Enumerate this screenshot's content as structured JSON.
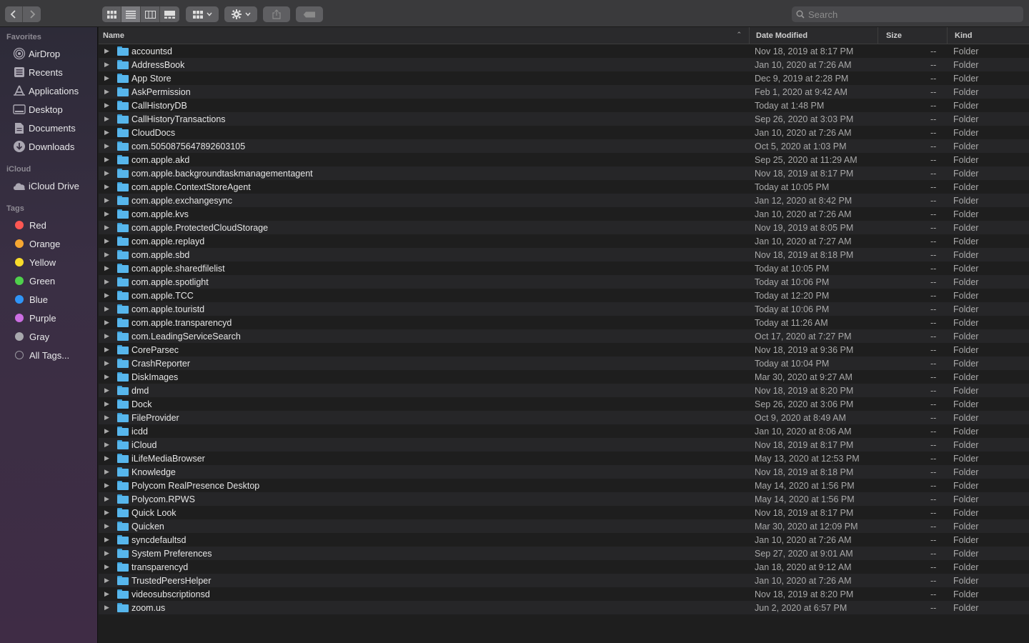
{
  "toolbar": {
    "back_icon": "chevron-left-icon",
    "forward_icon": "chevron-right-icon",
    "view_icons": [
      "icon-view-icon",
      "list-view-icon",
      "column-view-icon",
      "gallery-view-icon"
    ],
    "search_placeholder": "Search"
  },
  "sidebar": {
    "favorites_title": "Favorites",
    "favorites": [
      {
        "label": "AirDrop",
        "icon": "airdrop-icon"
      },
      {
        "label": "Recents",
        "icon": "recents-icon"
      },
      {
        "label": "Applications",
        "icon": "applications-icon"
      },
      {
        "label": "Desktop",
        "icon": "desktop-icon"
      },
      {
        "label": "Documents",
        "icon": "documents-icon"
      },
      {
        "label": "Downloads",
        "icon": "downloads-icon"
      }
    ],
    "icloud_title": "iCloud",
    "icloud": [
      {
        "label": "iCloud Drive",
        "icon": "icloud-icon"
      }
    ],
    "tags_title": "Tags",
    "tags": [
      {
        "label": "Red",
        "color": "#fd5753"
      },
      {
        "label": "Orange",
        "color": "#f6a732"
      },
      {
        "label": "Yellow",
        "color": "#f9dc2b"
      },
      {
        "label": "Green",
        "color": "#4fd04c"
      },
      {
        "label": "Blue",
        "color": "#2f95f7"
      },
      {
        "label": "Purple",
        "color": "#cc6ee2"
      },
      {
        "label": "Gray",
        "color": "#a8a8ad"
      },
      {
        "label": "All Tags...",
        "color": ""
      }
    ]
  },
  "columns": {
    "name": "Name",
    "date": "Date Modified",
    "size": "Size",
    "kind": "Kind"
  },
  "files": [
    {
      "name": "accountsd",
      "date": "Nov 18, 2019 at 8:17 PM",
      "size": "--",
      "kind": "Folder"
    },
    {
      "name": "AddressBook",
      "date": "Jan 10, 2020 at 7:26 AM",
      "size": "--",
      "kind": "Folder"
    },
    {
      "name": "App Store",
      "date": "Dec 9, 2019 at 2:28 PM",
      "size": "--",
      "kind": "Folder"
    },
    {
      "name": "AskPermission",
      "date": "Feb 1, 2020 at 9:42 AM",
      "size": "--",
      "kind": "Folder"
    },
    {
      "name": "CallHistoryDB",
      "date": "Today at 1:48 PM",
      "size": "--",
      "kind": "Folder"
    },
    {
      "name": "CallHistoryTransactions",
      "date": "Sep 26, 2020 at 3:03 PM",
      "size": "--",
      "kind": "Folder"
    },
    {
      "name": "CloudDocs",
      "date": "Jan 10, 2020 at 7:26 AM",
      "size": "--",
      "kind": "Folder"
    },
    {
      "name": "com.5050875647892603105",
      "date": "Oct 5, 2020 at 1:03 PM",
      "size": "--",
      "kind": "Folder"
    },
    {
      "name": "com.apple.akd",
      "date": "Sep 25, 2020 at 11:29 AM",
      "size": "--",
      "kind": "Folder"
    },
    {
      "name": "com.apple.backgroundtaskmanagementagent",
      "date": "Nov 18, 2019 at 8:17 PM",
      "size": "--",
      "kind": "Folder"
    },
    {
      "name": "com.apple.ContextStoreAgent",
      "date": "Today at 10:05 PM",
      "size": "--",
      "kind": "Folder"
    },
    {
      "name": "com.apple.exchangesync",
      "date": "Jan 12, 2020 at 8:42 PM",
      "size": "--",
      "kind": "Folder"
    },
    {
      "name": "com.apple.kvs",
      "date": "Jan 10, 2020 at 7:26 AM",
      "size": "--",
      "kind": "Folder"
    },
    {
      "name": "com.apple.ProtectedCloudStorage",
      "date": "Nov 19, 2019 at 8:05 PM",
      "size": "--",
      "kind": "Folder"
    },
    {
      "name": "com.apple.replayd",
      "date": "Jan 10, 2020 at 7:27 AM",
      "size": "--",
      "kind": "Folder"
    },
    {
      "name": "com.apple.sbd",
      "date": "Nov 18, 2019 at 8:18 PM",
      "size": "--",
      "kind": "Folder"
    },
    {
      "name": "com.apple.sharedfilelist",
      "date": "Today at 10:05 PM",
      "size": "--",
      "kind": "Folder"
    },
    {
      "name": "com.apple.spotlight",
      "date": "Today at 10:06 PM",
      "size": "--",
      "kind": "Folder"
    },
    {
      "name": "com.apple.TCC",
      "date": "Today at 12:20 PM",
      "size": "--",
      "kind": "Folder"
    },
    {
      "name": "com.apple.touristd",
      "date": "Today at 10:06 PM",
      "size": "--",
      "kind": "Folder"
    },
    {
      "name": "com.apple.transparencyd",
      "date": "Today at 11:26 AM",
      "size": "--",
      "kind": "Folder"
    },
    {
      "name": "com.LeadingServiceSearch",
      "date": "Oct 17, 2020 at 7:27 PM",
      "size": "--",
      "kind": "Folder"
    },
    {
      "name": "CoreParsec",
      "date": "Nov 18, 2019 at 9:36 PM",
      "size": "--",
      "kind": "Folder"
    },
    {
      "name": "CrashReporter",
      "date": "Today at 10:04 PM",
      "size": "--",
      "kind": "Folder"
    },
    {
      "name": "DiskImages",
      "date": "Mar 30, 2020 at 9:27 AM",
      "size": "--",
      "kind": "Folder"
    },
    {
      "name": "dmd",
      "date": "Nov 18, 2019 at 8:20 PM",
      "size": "--",
      "kind": "Folder"
    },
    {
      "name": "Dock",
      "date": "Sep 26, 2020 at 3:06 PM",
      "size": "--",
      "kind": "Folder"
    },
    {
      "name": "FileProvider",
      "date": "Oct 9, 2020 at 8:49 AM",
      "size": "--",
      "kind": "Folder"
    },
    {
      "name": "icdd",
      "date": "Jan 10, 2020 at 8:06 AM",
      "size": "--",
      "kind": "Folder"
    },
    {
      "name": "iCloud",
      "date": "Nov 18, 2019 at 8:17 PM",
      "size": "--",
      "kind": "Folder"
    },
    {
      "name": "iLifeMediaBrowser",
      "date": "May 13, 2020 at 12:53 PM",
      "size": "--",
      "kind": "Folder"
    },
    {
      "name": "Knowledge",
      "date": "Nov 18, 2019 at 8:18 PM",
      "size": "--",
      "kind": "Folder"
    },
    {
      "name": "Polycom RealPresence Desktop",
      "date": "May 14, 2020 at 1:56 PM",
      "size": "--",
      "kind": "Folder"
    },
    {
      "name": "Polycom.RPWS",
      "date": "May 14, 2020 at 1:56 PM",
      "size": "--",
      "kind": "Folder"
    },
    {
      "name": "Quick Look",
      "date": "Nov 18, 2019 at 8:17 PM",
      "size": "--",
      "kind": "Folder"
    },
    {
      "name": "Quicken",
      "date": "Mar 30, 2020 at 12:09 PM",
      "size": "--",
      "kind": "Folder"
    },
    {
      "name": "syncdefaultsd",
      "date": "Jan 10, 2020 at 7:26 AM",
      "size": "--",
      "kind": "Folder"
    },
    {
      "name": "System Preferences",
      "date": "Sep 27, 2020 at 9:01 AM",
      "size": "--",
      "kind": "Folder"
    },
    {
      "name": "transparencyd",
      "date": "Jan 18, 2020 at 9:12 AM",
      "size": "--",
      "kind": "Folder"
    },
    {
      "name": "TrustedPeersHelper",
      "date": "Jan 10, 2020 at 7:26 AM",
      "size": "--",
      "kind": "Folder"
    },
    {
      "name": "videosubscriptionsd",
      "date": "Nov 18, 2019 at 8:20 PM",
      "size": "--",
      "kind": "Folder"
    },
    {
      "name": "zoom.us",
      "date": "Jun 2, 2020 at 6:57 PM",
      "size": "--",
      "kind": "Folder"
    }
  ]
}
